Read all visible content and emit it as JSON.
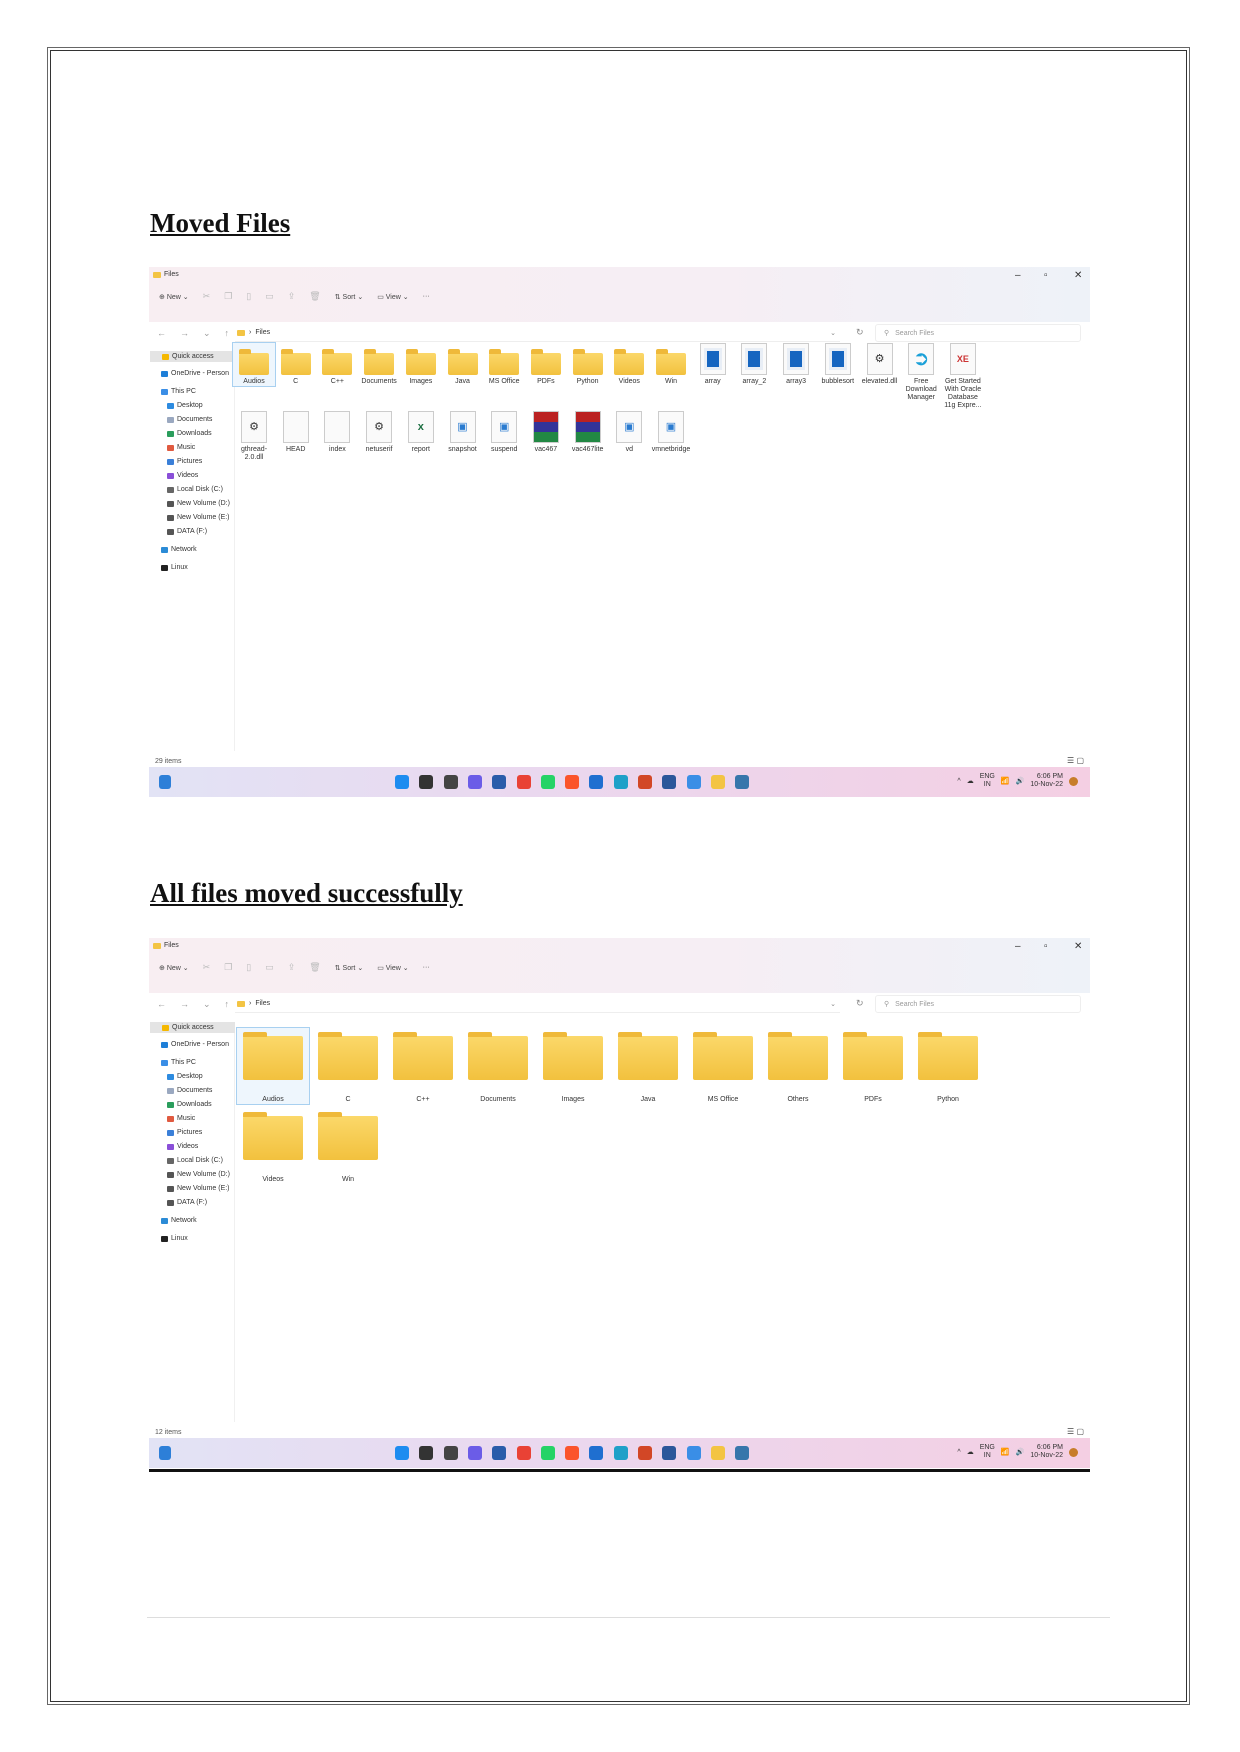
{
  "headings": [
    "Moved Files",
    "All files moved successfully"
  ],
  "explorer": {
    "title": "Files",
    "window_controls": [
      "–",
      "▫",
      "✕"
    ],
    "toolbar": {
      "new": "New",
      "sort": "Sort",
      "view": "View",
      "more": "···"
    },
    "nav": [
      "←",
      "→",
      "⌄",
      "↑"
    ],
    "address": "Files",
    "search_placeholder": "Search Files",
    "sidebar": [
      "Quick access",
      "OneDrive - Person",
      "This PC",
      "Desktop",
      "Documents",
      "Downloads",
      "Music",
      "Pictures",
      "Videos",
      "Local Disk (C:)",
      "New Volume (D:)",
      "New Volume (E:)",
      "DATA (F:)",
      "Network",
      "Linux"
    ],
    "tray": {
      "lang": "ENG",
      "region": "IN",
      "time": "6:06 PM",
      "date": "10-Nov-22"
    }
  },
  "screens": [
    {
      "status": "29 items",
      "items": [
        {
          "name": "Audios",
          "type": "folder"
        },
        {
          "name": "C",
          "type": "folder"
        },
        {
          "name": "C++",
          "type": "folder"
        },
        {
          "name": "Documents",
          "type": "folder"
        },
        {
          "name": "Images",
          "type": "folder"
        },
        {
          "name": "Java",
          "type": "folder"
        },
        {
          "name": "MS Office",
          "type": "folder"
        },
        {
          "name": "PDFs",
          "type": "folder"
        },
        {
          "name": "Python",
          "type": "folder"
        },
        {
          "name": "Videos",
          "type": "folder"
        },
        {
          "name": "Win",
          "type": "folder"
        },
        {
          "name": "array",
          "type": "exe"
        },
        {
          "name": "array_2",
          "type": "exe"
        },
        {
          "name": "array3",
          "type": "exe"
        },
        {
          "name": "bubblesort",
          "type": "exe"
        },
        {
          "name": "elevated.dll",
          "type": "dll"
        },
        {
          "name": "Free Download Manager",
          "type": "shortcut"
        },
        {
          "name": "Get Started With Oracle Database 11g Expre...",
          "type": "db"
        },
        {
          "name": "gthread-2.0.dll",
          "type": "dll"
        },
        {
          "name": "HEAD",
          "type": "blank"
        },
        {
          "name": "index",
          "type": "blank"
        },
        {
          "name": "netuserif",
          "type": "dll"
        },
        {
          "name": "report",
          "type": "excel"
        },
        {
          "name": "snapshot",
          "type": "app"
        },
        {
          "name": "suspend",
          "type": "app"
        },
        {
          "name": "vac467",
          "type": "rar"
        },
        {
          "name": "vac467lite",
          "type": "rar"
        },
        {
          "name": "vd",
          "type": "app"
        },
        {
          "name": "vmnetbridge",
          "type": "app"
        }
      ]
    },
    {
      "status": "12 items",
      "items": [
        {
          "name": "Audios",
          "type": "folder"
        },
        {
          "name": "C",
          "type": "folder"
        },
        {
          "name": "C++",
          "type": "folder"
        },
        {
          "name": "Documents",
          "type": "folder"
        },
        {
          "name": "Images",
          "type": "folder"
        },
        {
          "name": "Java",
          "type": "folder"
        },
        {
          "name": "MS Office",
          "type": "folder"
        },
        {
          "name": "Others",
          "type": "folder"
        },
        {
          "name": "PDFs",
          "type": "folder"
        },
        {
          "name": "Python",
          "type": "folder"
        },
        {
          "name": "Videos",
          "type": "folder"
        },
        {
          "name": "Win",
          "type": "folder"
        }
      ]
    }
  ],
  "taskbar_apps": [
    {
      "name": "start",
      "color": "#1d8cf0"
    },
    {
      "name": "search",
      "color": "#333333"
    },
    {
      "name": "task-view",
      "color": "#444444"
    },
    {
      "name": "chat",
      "color": "#6b5ce7"
    },
    {
      "name": "store",
      "color": "#2a5caa"
    },
    {
      "name": "chrome",
      "color": "#e94235"
    },
    {
      "name": "whatsapp",
      "color": "#25d366"
    },
    {
      "name": "brave",
      "color": "#fb542b"
    },
    {
      "name": "vscode",
      "color": "#1f6fd0"
    },
    {
      "name": "edge",
      "color": "#1fa0c8"
    },
    {
      "name": "powerpoint",
      "color": "#d24726"
    },
    {
      "name": "word",
      "color": "#2b579a"
    },
    {
      "name": "notepad",
      "color": "#3a8ee6"
    },
    {
      "name": "file-explorer",
      "color": "#f3c443"
    },
    {
      "name": "python-idle",
      "color": "#3776ab"
    }
  ]
}
